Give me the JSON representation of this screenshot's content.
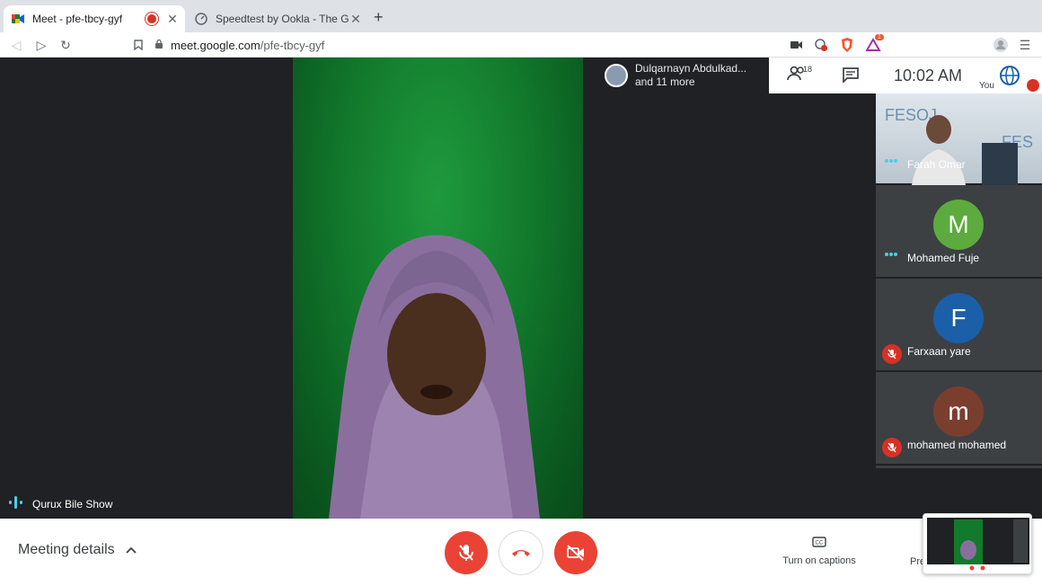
{
  "browser": {
    "tabs": [
      {
        "title": "Meet - pfe-tbcy-gyf",
        "active": true
      },
      {
        "title": "Speedtest by Ookla - The Globa",
        "active": false
      }
    ],
    "url_host": "meet.google.com",
    "url_path": "/pfe-tbcy-gyf",
    "brave_badge": "1"
  },
  "meet": {
    "top_info": {
      "name": "Dulqarnayn Abdulkad...",
      "more": "and 11 more"
    },
    "participant_count": "18",
    "time": "10:02  AM",
    "you_label": "You",
    "main_speaker": "Qurux Bile Show",
    "sidebar": [
      {
        "name": "Farah Omar",
        "type": "video",
        "status": "speaking"
      },
      {
        "name": "Mohamed Fuje",
        "initial": "M",
        "color": "#5dab3e",
        "status": "speaking"
      },
      {
        "name": "Farxaan yare",
        "initial": "F",
        "color": "#1a5fa8",
        "status": "muted"
      },
      {
        "name": "mohamed mohamed",
        "initial": "m",
        "color": "#7a3e2e",
        "status": "muted"
      }
    ],
    "controls": {
      "meeting_details": "Meeting details",
      "captions": "Turn on captions",
      "present": "Pre"
    }
  }
}
